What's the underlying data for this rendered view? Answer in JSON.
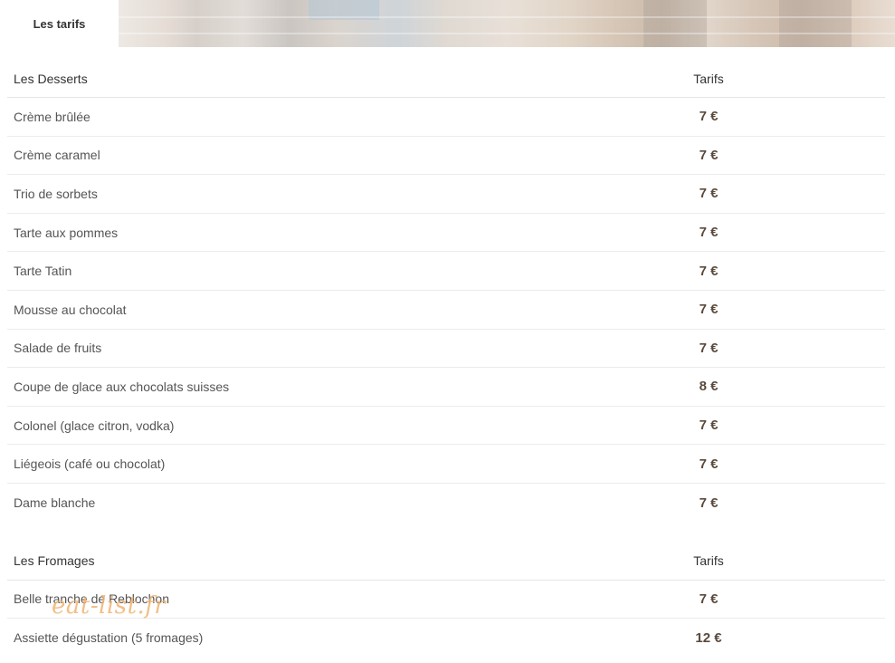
{
  "header": {
    "tab_label": "Les tarifs"
  },
  "colors": {
    "price_text": "#5a4a3c",
    "watermark": "#f0b474",
    "divider": "#ececec"
  },
  "sections": [
    {
      "title": "Les Desserts",
      "price_header": "Tarifs",
      "items": [
        {
          "name": "Crème brûlée",
          "price": "7 €"
        },
        {
          "name": "Crème caramel",
          "price": "7 €"
        },
        {
          "name": "Trio de sorbets",
          "price": "7 €"
        },
        {
          "name": "Tarte aux pommes",
          "price": "7 €"
        },
        {
          "name": "Tarte Tatin",
          "price": "7 €"
        },
        {
          "name": "Mousse au chocolat",
          "price": "7 €"
        },
        {
          "name": "Salade de fruits",
          "price": "7 €"
        },
        {
          "name": "Coupe de glace aux chocolats suisses",
          "price": "8 €"
        },
        {
          "name": "Colonel (glace citron, vodka)",
          "price": "7 €"
        },
        {
          "name": "Liégeois (café ou chocolat)",
          "price": "7 €"
        },
        {
          "name": "Dame blanche",
          "price": "7 €"
        }
      ]
    },
    {
      "title": "Les Fromages",
      "price_header": "Tarifs",
      "items": [
        {
          "name": "Belle tranche de Reblochon",
          "price": "7 €"
        },
        {
          "name": "Assiette dégustation (5 fromages)",
          "price": "12 €"
        }
      ]
    }
  ],
  "watermark": "eat-list.fr"
}
